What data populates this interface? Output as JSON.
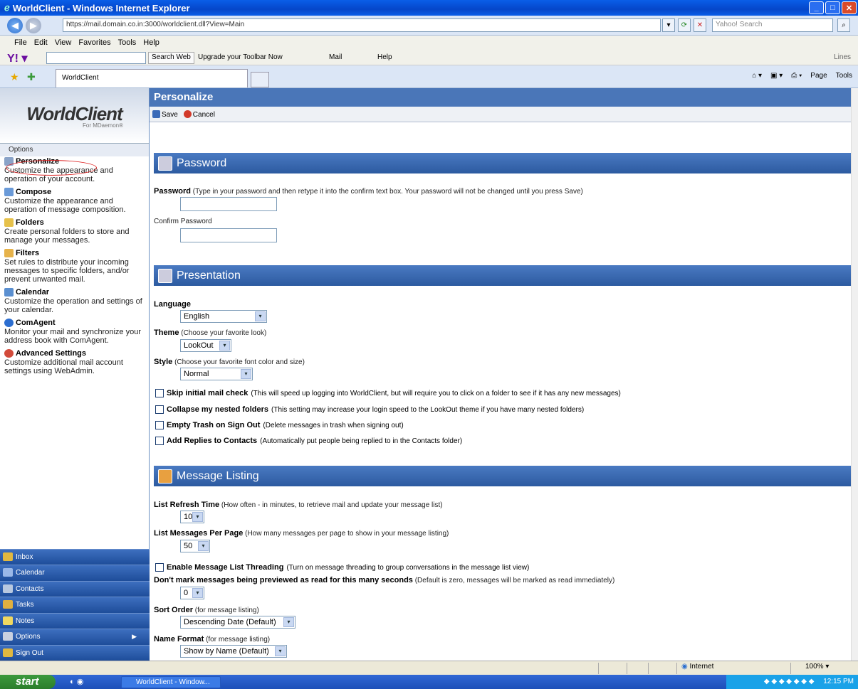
{
  "browser": {
    "title": "WorldClient - Windows Internet Explorer",
    "url": "https://mail.domain.co.in:3000/worldclient.dll?View=Main",
    "search_placeholder": "Yahoo! Search",
    "menu": [
      "File",
      "Edit",
      "View",
      "Favorites",
      "Tools",
      "Help"
    ],
    "toolbar": {
      "search_web": "Search Web",
      "upgrade": "Upgrade your Toolbar Now",
      "mail": "Mail",
      "help": "Help",
      "lines": "Lines"
    },
    "tab_title": "WorldClient",
    "tab_tools": {
      "page": "Page",
      "tools": "Tools"
    }
  },
  "sidebar": {
    "logo": "WorldClient",
    "logo_sub": "For MDaemon®",
    "options_label": "Options",
    "items": [
      {
        "title": "Personalize",
        "desc": "Customize the appearance and operation of your account."
      },
      {
        "title": "Compose",
        "desc": "Customize the appearance and operation of message composition."
      },
      {
        "title": "Folders",
        "desc": "Create personal folders to store and manage your messages."
      },
      {
        "title": "Filters",
        "desc": "Set rules to distribute your incoming messages to specific folders, and/or prevent unwanted mail."
      },
      {
        "title": "Calendar",
        "desc": "Customize the operation and settings of your calendar."
      },
      {
        "title": "ComAgent",
        "desc": "Monitor your mail and synchronize your address book with ComAgent."
      },
      {
        "title": "Advanced Settings",
        "desc": "Customize additional mail account settings using WebAdmin."
      }
    ],
    "nav": [
      "Inbox",
      "Calendar",
      "Contacts",
      "Tasks",
      "Notes",
      "Options",
      "Sign Out"
    ]
  },
  "main": {
    "title": "Personalize",
    "save": "Save",
    "cancel": "Cancel",
    "password_section": "Password",
    "password_label": "Password",
    "password_hint": "(Type in your password and then retype it into the confirm text box. Your password will not be changed until you press Save)",
    "confirm_label": "Confirm Password",
    "presentation_section": "Presentation",
    "language_label": "Language",
    "language_value": "English",
    "theme_label": "Theme",
    "theme_hint": "(Choose your favorite look)",
    "theme_value": "LookOut",
    "style_label": "Style",
    "style_hint": "(Choose your favorite font color and size)",
    "style_value": "Normal",
    "checks": [
      {
        "label": "Skip initial mail check",
        "hint": "(This will speed up logging into WorldClient, but will require you to click on a folder to see if it has any new messages)"
      },
      {
        "label": "Collapse my nested folders",
        "hint": "(This setting may increase your login speed to the LookOut theme if you have many nested folders)"
      },
      {
        "label": "Empty Trash on Sign Out",
        "hint": "(Delete messages in trash when signing out)"
      },
      {
        "label": "Add Replies to Contacts",
        "hint": "(Automatically put people being replied to in the Contacts folder)"
      }
    ],
    "listing_section": "Message Listing",
    "refresh_label": "List Refresh Time",
    "refresh_hint": "(How often - in minutes, to retrieve mail and update your message list)",
    "refresh_value": "10",
    "perpage_label": "List Messages Per Page",
    "perpage_hint": "(How many messages per page to show in your message listing)",
    "perpage_value": "50",
    "threading_label": "Enable Message List Threading",
    "threading_hint": "(Turn on message threading to group conversations in the message list view)",
    "preview_label": "Don't mark messages being previewed as read for this many seconds",
    "preview_hint": "(Default is zero, messages will be marked as read immediately)",
    "preview_value": "0",
    "sort_label": "Sort Order",
    "sort_hint": "(for message listing)",
    "sort_value": "Descending Date (Default)",
    "name_label": "Name Format",
    "name_hint": "(for message listing)",
    "name_value": "Show by Name (Default)"
  },
  "status": {
    "zone": "Internet",
    "zoom": "100%"
  },
  "taskbar": {
    "start": "start",
    "task": "WorldClient - Window...",
    "clock": "12:15 PM"
  }
}
